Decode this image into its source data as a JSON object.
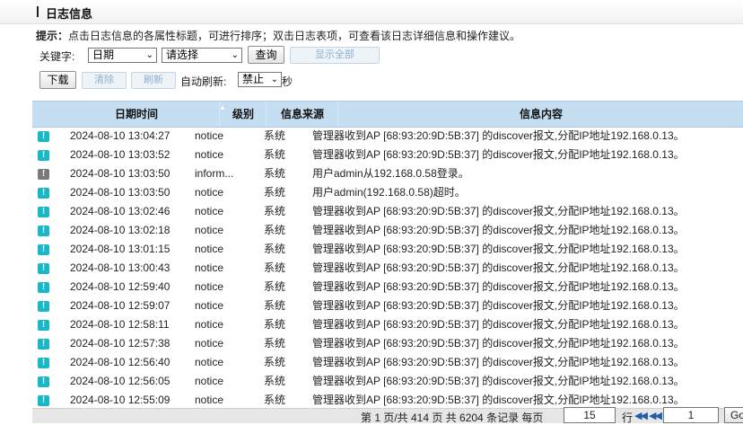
{
  "header": {
    "title": "日志信息"
  },
  "hint": {
    "label": "提示：",
    "text": "点击日志信息的各属性标题，可进行排序；双击日志表项，可查看该日志详细信息和操作建议。"
  },
  "filter": {
    "keyword_label": "关键字:",
    "field_select": "日期",
    "value_select": "请选择",
    "query_button": "查询",
    "show_all_button": "显示全部"
  },
  "toolbar": {
    "download_button": "下载",
    "clear_button": "清除",
    "refresh_button": "刷新",
    "auto_refresh_label": "自动刷新:",
    "auto_refresh_value": "禁止",
    "seconds_unit": "秒"
  },
  "table": {
    "columns": [
      "日期时间",
      "级别",
      "信息来源",
      "信息内容"
    ],
    "rows": [
      {
        "level_icon": "notice",
        "time": "2024-08-10 13:04:27",
        "level": "notice",
        "source": "系统",
        "message": "管理器收到AP [68:93:20:9D:5B:37] 的discover报文,分配IP地址192.168.0.13。"
      },
      {
        "level_icon": "notice",
        "time": "2024-08-10 13:03:52",
        "level": "notice",
        "source": "系统",
        "message": "管理器收到AP [68:93:20:9D:5B:37] 的discover报文,分配IP地址192.168.0.13。"
      },
      {
        "level_icon": "info",
        "time": "2024-08-10 13:03:50",
        "level": "inform...",
        "source": "系统",
        "message": "用户admin从192.168.0.58登录。"
      },
      {
        "level_icon": "notice",
        "time": "2024-08-10 13:03:50",
        "level": "notice",
        "source": "系统",
        "message": "用户admin(192.168.0.58)超时。"
      },
      {
        "level_icon": "notice",
        "time": "2024-08-10 13:02:46",
        "level": "notice",
        "source": "系统",
        "message": "管理器收到AP [68:93:20:9D:5B:37] 的discover报文,分配IP地址192.168.0.13。"
      },
      {
        "level_icon": "notice",
        "time": "2024-08-10 13:02:18",
        "level": "notice",
        "source": "系统",
        "message": "管理器收到AP [68:93:20:9D:5B:37] 的discover报文,分配IP地址192.168.0.13。"
      },
      {
        "level_icon": "notice",
        "time": "2024-08-10 13:01:15",
        "level": "notice",
        "source": "系统",
        "message": "管理器收到AP [68:93:20:9D:5B:37] 的discover报文,分配IP地址192.168.0.13。"
      },
      {
        "level_icon": "notice",
        "time": "2024-08-10 13:00:43",
        "level": "notice",
        "source": "系统",
        "message": "管理器收到AP [68:93:20:9D:5B:37] 的discover报文,分配IP地址192.168.0.13。"
      },
      {
        "level_icon": "notice",
        "time": "2024-08-10 12:59:40",
        "level": "notice",
        "source": "系统",
        "message": "管理器收到AP [68:93:20:9D:5B:37] 的discover报文,分配IP地址192.168.0.13。"
      },
      {
        "level_icon": "notice",
        "time": "2024-08-10 12:59:07",
        "level": "notice",
        "source": "系统",
        "message": "管理器收到AP [68:93:20:9D:5B:37] 的discover报文,分配IP地址192.168.0.13。"
      },
      {
        "level_icon": "notice",
        "time": "2024-08-10 12:58:11",
        "level": "notice",
        "source": "系统",
        "message": "管理器收到AP [68:93:20:9D:5B:37] 的discover报文,分配IP地址192.168.0.13。"
      },
      {
        "level_icon": "notice",
        "time": "2024-08-10 12:57:38",
        "level": "notice",
        "source": "系统",
        "message": "管理器收到AP [68:93:20:9D:5B:37] 的discover报文,分配IP地址192.168.0.13。"
      },
      {
        "level_icon": "notice",
        "time": "2024-08-10 12:56:40",
        "level": "notice",
        "source": "系统",
        "message": "管理器收到AP [68:93:20:9D:5B:37] 的discover报文,分配IP地址192.168.0.13。"
      },
      {
        "level_icon": "notice",
        "time": "2024-08-10 12:56:05",
        "level": "notice",
        "source": "系统",
        "message": "管理器收到AP [68:93:20:9D:5B:37] 的discover报文,分配IP地址192.168.0.13。"
      },
      {
        "level_icon": "notice",
        "time": "2024-08-10 12:55:09",
        "level": "notice",
        "source": "系统",
        "message": "管理器收到AP [68:93:20:9D:5B:37] 的discover报文,分配IP地址192.168.0.13。"
      }
    ]
  },
  "pager": {
    "summary": "第 1 页/共 414 页 共 6204 条记录 每页",
    "page_size": "15",
    "rows_unit": "行",
    "page_input": "1",
    "go_button": "Go"
  },
  "colors": {
    "header_bg": "#c5ddf1",
    "notice_icon": "#19b8c8",
    "info_icon": "#7a7a7a"
  }
}
